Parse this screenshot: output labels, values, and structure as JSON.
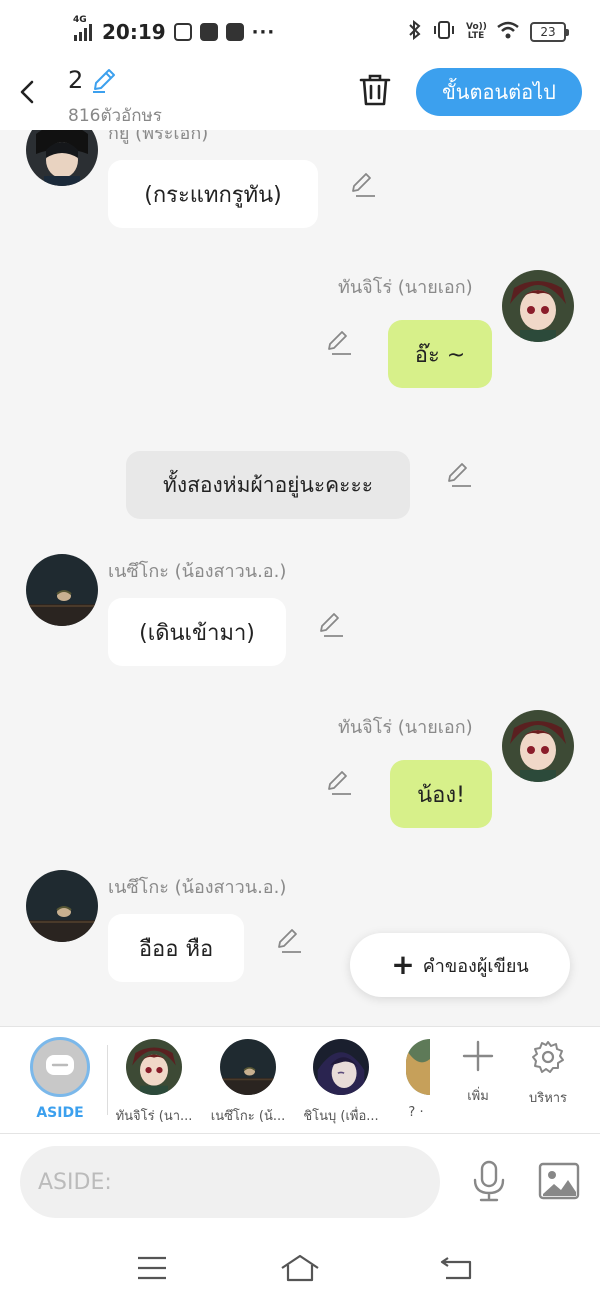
{
  "status_bar": {
    "network": "4G",
    "time": "20:19",
    "dots": "···",
    "volte": "Vo)) LTE",
    "battery": "23"
  },
  "header": {
    "chapter": "2",
    "char_count": "816ตัวอักษร",
    "next_label": "ขั้นตอนต่อไป"
  },
  "messages": [
    {
      "name": "กยู (พระเอก)",
      "text": "(กระแทกรูทัน)",
      "side": "left"
    },
    {
      "name": "ทันจิโร่ (นายเอก)",
      "text": "อ๊ะ ~",
      "side": "right"
    },
    {
      "text": "ทั้งสองห่มผ้าอยู่นะคะะะ",
      "side": "aside"
    },
    {
      "name": "เนซึโกะ (น้องสาวน.อ.)",
      "text": "(เดินเข้ามา)",
      "side": "left"
    },
    {
      "name": "ทันจิโร่ (นายเอก)",
      "text": "น้อง!",
      "side": "right"
    },
    {
      "name": "เนซึโกะ (น้องสาวน.อ.)",
      "text": "อืออ หือ",
      "side": "left"
    }
  ],
  "fab_label": "คำของผู้เขียน",
  "character_bar": {
    "aside_label": "ASIDE",
    "characters": [
      "ทันจิโร่ (นา...",
      "เนซึโกะ (น้...",
      "ชิโนบุ (เพื่อ...",
      "? ·"
    ],
    "add_label": "เพิ่ม",
    "manage_label": "บริหาร"
  },
  "input": {
    "placeholder": "ASIDE:"
  },
  "colors": {
    "accent": "#3ca0ee",
    "right_bubble": "#d7f08a",
    "aside_bubble": "#e8e8e8"
  }
}
